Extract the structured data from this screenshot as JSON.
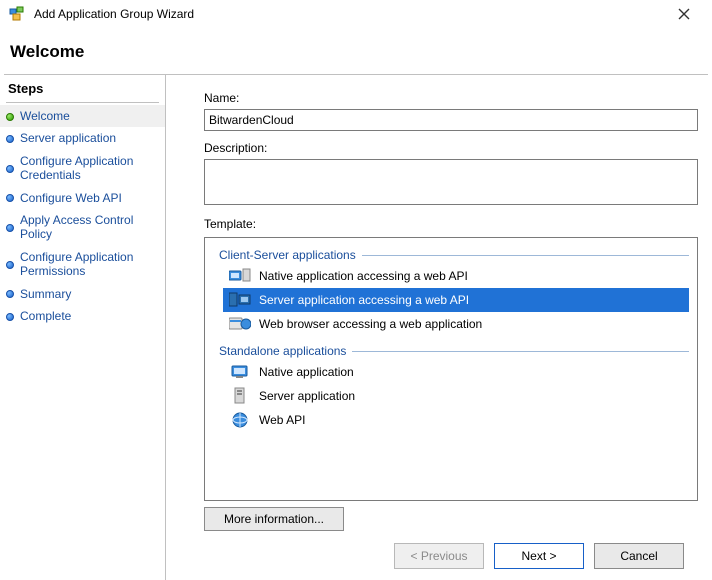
{
  "window": {
    "title": "Add Application Group Wizard"
  },
  "page_header": "Welcome",
  "sidebar": {
    "title": "Steps",
    "items": [
      {
        "label": "Welcome",
        "state": "current"
      },
      {
        "label": "Server application",
        "state": "pending"
      },
      {
        "label": "Configure Application Credentials",
        "state": "pending"
      },
      {
        "label": "Configure Web API",
        "state": "pending"
      },
      {
        "label": "Apply Access Control Policy",
        "state": "pending"
      },
      {
        "label": "Configure Application Permissions",
        "state": "pending"
      },
      {
        "label": "Summary",
        "state": "pending"
      },
      {
        "label": "Complete",
        "state": "pending"
      }
    ]
  },
  "form": {
    "name_label": "Name:",
    "name_value": "BitwardenCloud",
    "desc_label": "Description:",
    "desc_value": "",
    "template_label": "Template:",
    "groups": [
      {
        "title": "Client-Server applications",
        "items": [
          {
            "label": "Native application accessing a web API",
            "icon": "native-client-api",
            "selected": false
          },
          {
            "label": "Server application accessing a web API",
            "icon": "server-client-api",
            "selected": true
          },
          {
            "label": "Web browser accessing a web application",
            "icon": "browser-webapp",
            "selected": false
          }
        ]
      },
      {
        "title": "Standalone applications",
        "items": [
          {
            "label": "Native application",
            "icon": "native-app",
            "selected": false
          },
          {
            "label": "Server application",
            "icon": "server-app",
            "selected": false
          },
          {
            "label": "Web API",
            "icon": "web-api",
            "selected": false
          }
        ]
      }
    ],
    "more_info": "More information..."
  },
  "buttons": {
    "prev": "< Previous",
    "next": "Next >",
    "cancel": "Cancel"
  }
}
